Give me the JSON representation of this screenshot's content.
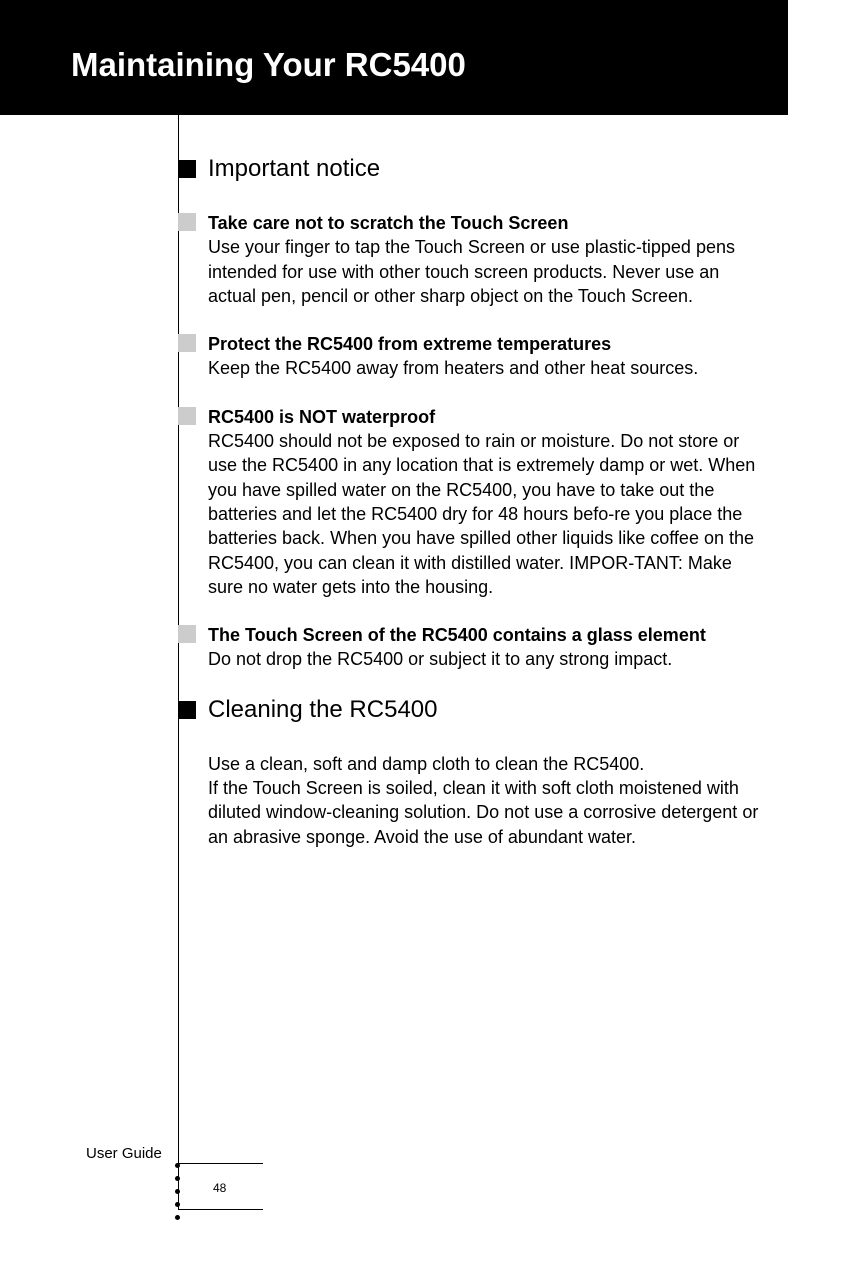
{
  "header": {
    "title": "Maintaining Your RC5400"
  },
  "section1": {
    "title": "Important notice",
    "items": [
      {
        "title": "Take care not to scratch the Touch Screen",
        "body": "Use your finger to tap the Touch Screen or use plastic-tipped pens intended for use with other touch screen products. Never use an actual pen, pencil or other sharp object on the Touch Screen."
      },
      {
        "title": "Protect the RC5400 from extreme temperatures",
        "body": "Keep the RC5400 away from heaters and other heat sources."
      },
      {
        "title": "RC5400 is NOT waterproof",
        "body": "RC5400 should not be exposed to rain or moisture. Do not store or use the RC5400 in any location that is extremely damp or wet. When you have spilled water on the RC5400, you have to take out the batteries and let the RC5400 dry for 48 hours befo-re you place the batteries back. When you have spilled other liquids like coffee on the RC5400, you can clean it with distilled water.                                                                  IMPOR-TANT: Make sure no water gets into the housing."
      },
      {
        "title": "The Touch Screen of the RC5400 contains a glass element",
        "body": "Do not drop the RC5400 or subject it to any strong impact."
      }
    ]
  },
  "section2": {
    "title": "Cleaning the RC5400",
    "body": "Use a clean, soft and damp cloth to clean the RC5400.\nIf the Touch Screen is soiled, clean it with soft cloth moistened with diluted window-cleaning solution. Do not use a corrosive detergent or an abrasive sponge. Avoid the use of abundant water."
  },
  "footer": {
    "user_guide": "User Guide",
    "page_number": "48"
  }
}
